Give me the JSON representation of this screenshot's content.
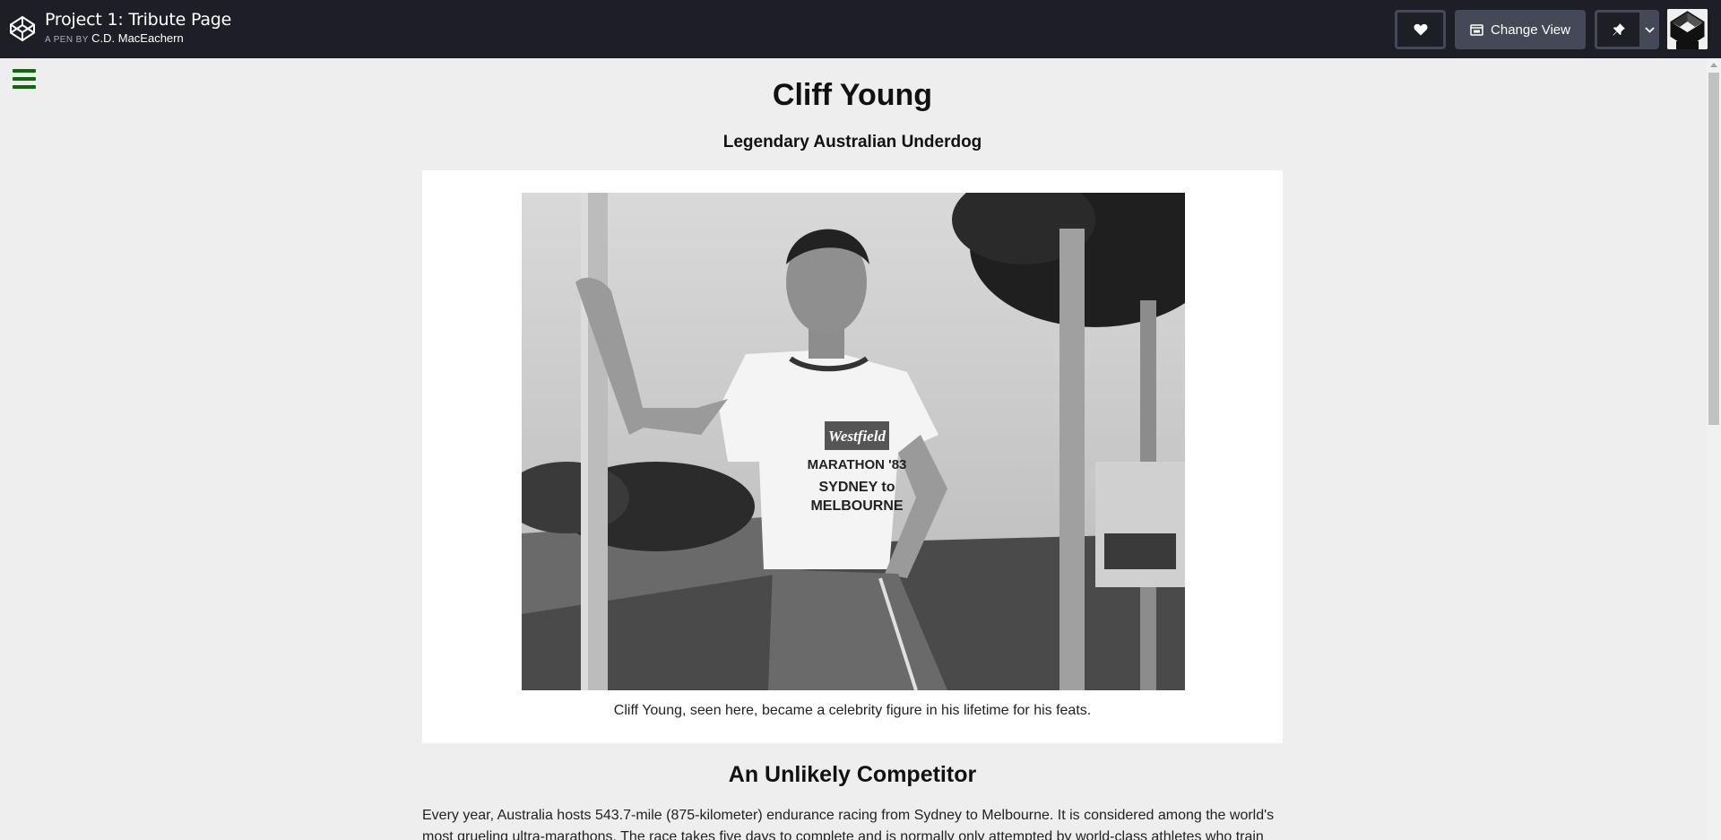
{
  "topbar": {
    "pen_title": "Project 1: Tribute Page",
    "by_label": "A PEN BY",
    "author": "C.D. MacEachern",
    "change_view_label": "Change View",
    "icons": [
      "codepen-logo-icon",
      "heart-icon",
      "change-view-icon",
      "pin-icon",
      "chevron-down-icon",
      "user-avatar"
    ]
  },
  "page": {
    "title": "Cliff Young",
    "subtitle": "Legendary Australian Underdog",
    "image_alt": "Cliff Young",
    "caption": "Cliff Young, seen here, became a celebrity figure in his lifetime for his feats.",
    "section_title": "An Unlikely Competitor",
    "paragraph": "Every year, Australia hosts 543.7-mile (875-kilometer) endurance racing from Sydney to Melbourne. It is considered among the world's most grueling ultra-marathons. The race takes five days to complete and is normally only attempted by world-class athletes who train",
    "menu_icon": "hamburger-menu-icon"
  },
  "photo_shirt": {
    "brand": "Westfield",
    "line1": "MARATHON '83",
    "line2": "SYDNEY to",
    "line3": "MELBOURNE"
  },
  "colors": {
    "topbar_bg": "#1e1f26",
    "button_bg": "#444857",
    "page_bg": "#eeeeee",
    "menu_icon": "#0b6b0b"
  }
}
